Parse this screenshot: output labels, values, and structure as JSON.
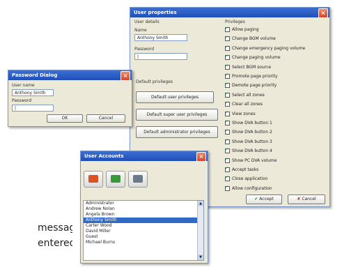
{
  "user_properties": {
    "title": "User properties",
    "close": "×",
    "user_details_label": "User details",
    "name_label": "Name",
    "name_value": "Anthony Smith",
    "password_label": "Password",
    "password_value": "|",
    "default_privileges_label": "Default privileges",
    "btn_default_user": "Default user privileges",
    "btn_default_super": "Default super user privileges",
    "btn_default_admin": "Default administrator privileges",
    "privileges_label": "Privileges",
    "privileges": [
      "Allow paging",
      "Change BGM volume",
      "Change emergency paging volume",
      "Change paging volume",
      "Select BGM source",
      "Promote page priority",
      "Demote page priority",
      "Select all zones",
      "Clear all zones",
      "View zones",
      "Show DVA button 1",
      "Show DVA button 2",
      "Show DVA button 3",
      "Show DVA button 4",
      "Show PC DVA volume",
      "Accept tasks",
      "Close application",
      "Allow configuration"
    ],
    "accept": "Accept",
    "cancel": "Cancel"
  },
  "password_dialog": {
    "title": "Password Dialog",
    "close": "×",
    "user_name_label": "User name",
    "user_name_value": "Anthony Smith",
    "password_label": "Password",
    "password_value": "|",
    "ok": "OK",
    "cancel": "Cancel"
  },
  "user_accounts": {
    "title": "User Accounts",
    "close": "×",
    "icons": [
      "add-user-icon",
      "edit-user-icon",
      "delete-user-icon"
    ],
    "colors": [
      "#d9541e",
      "#3a9a3a",
      "#6a7a8a"
    ],
    "users": [
      "Administrator",
      "Andrew Nolan",
      "Angela Brown",
      "Anthony Smith",
      "Carter Wood",
      "David Miller",
      "Guest",
      "Michael Burns"
    ],
    "selected": "Anthony Smith"
  },
  "caption": {
    "line1": "message",
    "line2": "entered"
  }
}
